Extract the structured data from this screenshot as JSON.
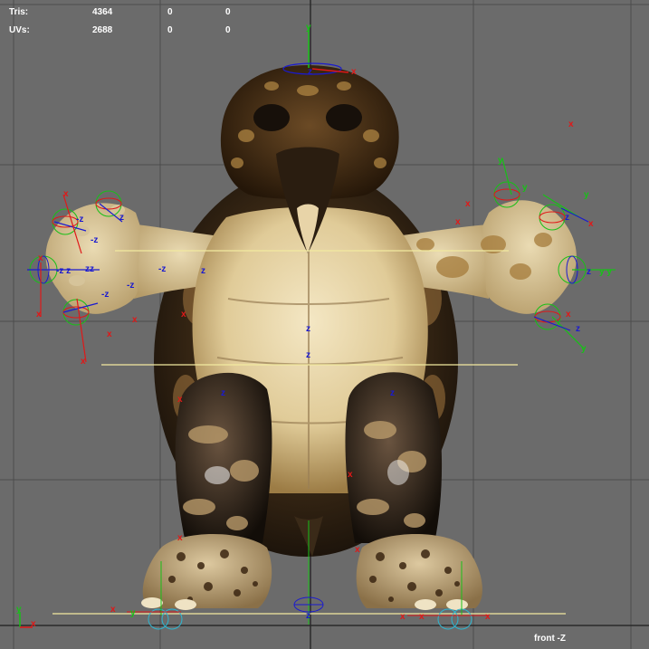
{
  "hud": {
    "tris": {
      "label": "Tris:",
      "values": [
        "4364",
        "0",
        "0"
      ]
    },
    "uvs": {
      "label": "UVs:",
      "values": [
        "2688",
        "0",
        "0"
      ]
    }
  },
  "viewport": {
    "camera_label": "front -Z",
    "background": "#6b6b6b",
    "grid_color": "#4d4d4d",
    "axis_colors": {
      "x": "#e01818",
      "y": "#18c018",
      "z": "#1a1ad0"
    },
    "guide_line_color": "#f2eaa0"
  },
  "scene": {
    "model": "turtle-character-mesh",
    "pose": "T-pose",
    "labels": {
      "x": "X",
      "y": "Y",
      "z": "Z"
    }
  }
}
